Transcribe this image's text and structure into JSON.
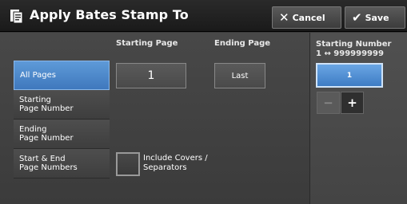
{
  "header": {
    "title": "Apply Bates Stamp To",
    "title_icon": "document-stamp-icon",
    "cancel_label": "Cancel",
    "cancel_icon": "close-icon",
    "save_label": "Save",
    "save_icon": "checkmark-icon"
  },
  "columns": {
    "starting_page": "Starting Page",
    "ending_page": "Ending Page",
    "starting_number": "Starting Number",
    "starting_number_range": "1 ↔ 999999999"
  },
  "page_options": [
    {
      "label": "All Pages",
      "selected": true
    },
    {
      "label": "Starting\nPage Number",
      "selected": false
    },
    {
      "label": "Ending\nPage Number",
      "selected": false
    },
    {
      "label": "Start & End\nPage Numbers",
      "selected": false
    }
  ],
  "fields": {
    "starting_page_value": "1",
    "ending_page_value": "Last",
    "starting_number_value": "1",
    "minus_label": "−",
    "plus_label": "+"
  },
  "include_covers": {
    "label": "Include Covers /\nSeparators",
    "checked": false
  },
  "colors": {
    "accent": "#4a86cc",
    "background": "#424242"
  }
}
